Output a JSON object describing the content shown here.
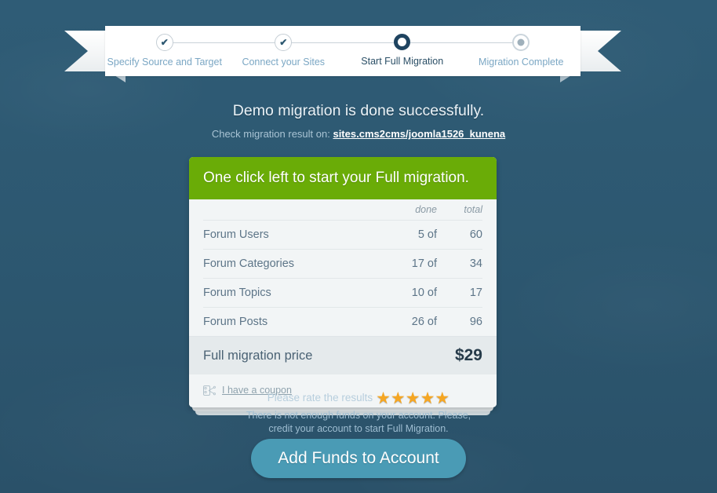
{
  "progress": {
    "steps": [
      {
        "label": "Specify Source and Target",
        "state": "done",
        "icon": "check-icon"
      },
      {
        "label": "Connect your Sites",
        "state": "done",
        "icon": "check-icon"
      },
      {
        "label": "Start Full Migration",
        "state": "current",
        "icon": "ring-icon"
      },
      {
        "label": "Migration Complete",
        "state": "todo",
        "icon": "dot-icon"
      }
    ]
  },
  "headline": "Demo migration is done successfully.",
  "subline": {
    "prefix": "Check migration result on:",
    "link_text": "sites.cms2cms/joomla1526_kunena"
  },
  "card": {
    "header": "One click left to start your Full migration.",
    "columns": {
      "label": "",
      "done": "done",
      "total": "total"
    },
    "rows": [
      {
        "label": "Forum Users",
        "done": "5 of",
        "total": "60"
      },
      {
        "label": "Forum Categories",
        "done": "17 of",
        "total": "34"
      },
      {
        "label": "Forum Topics",
        "done": "10 of",
        "total": "17"
      },
      {
        "label": "Forum Posts",
        "done": "26 of",
        "total": "96"
      }
    ],
    "price": {
      "label": "Full migration price",
      "value": "$29"
    },
    "coupon": {
      "icon": "scissors-icon",
      "label": "I have a coupon"
    }
  },
  "rating": {
    "label": "Please rate the results",
    "stars": "★★★★★",
    "star_count": 5,
    "star_color": "#f5a623"
  },
  "funds_note": {
    "line1": "There is not enough funds on your account. Please,",
    "line2": "credit your account to start Full Migration."
  },
  "cta": {
    "label": "Add Funds to Account"
  },
  "colors": {
    "background": "#2d5871",
    "card_header_green": "#6aac07",
    "cta_teal": "#4a9bb5",
    "link_white": "#ffffff",
    "star_gold": "#f5a623"
  }
}
